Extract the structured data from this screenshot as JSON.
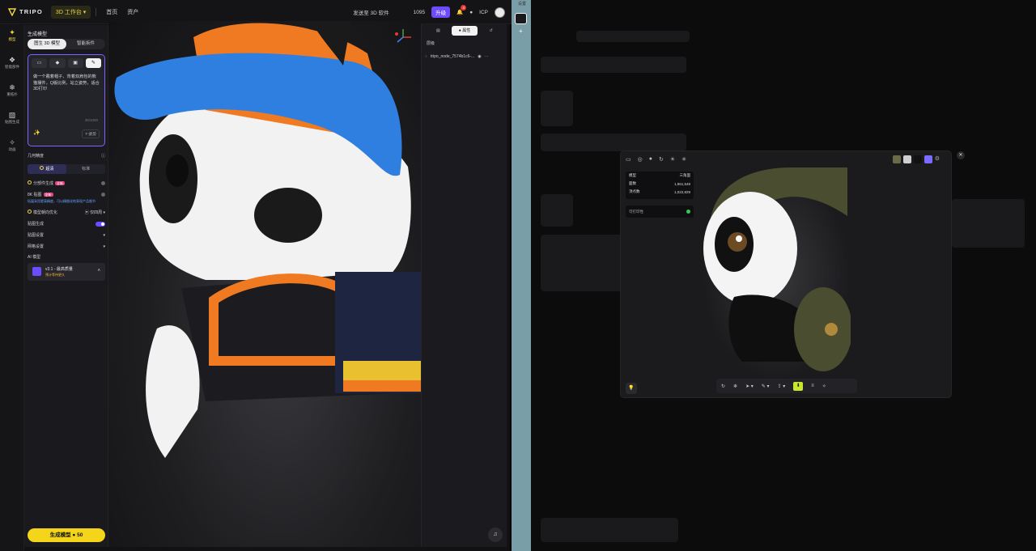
{
  "topbar": {
    "brand": "TRIPO",
    "workspace": "3D 工作台",
    "workspace_caret": "▾",
    "nav": [
      "首页",
      "资产"
    ],
    "send_to": "发送至 3D 软件",
    "credits": "1095",
    "upgrade": "升级",
    "notif_count": "4",
    "lang": "ICP"
  },
  "rail": [
    {
      "icon": "✦",
      "label": "模型"
    },
    {
      "icon": "❖",
      "label": "智能部件"
    },
    {
      "icon": "❄",
      "label": "重拓扑"
    },
    {
      "icon": "▨",
      "label": "贴图生成"
    },
    {
      "icon": "✧",
      "label": "动画"
    }
  ],
  "panel": {
    "title": "生成模型",
    "seg": [
      "图生 3D 模型",
      "智能拆件"
    ],
    "prompt": "做一个戴着帽子、背着双肩包的熊猫摆件，Q版比例，站立姿势，适合3D打印",
    "counter": "35/1000",
    "pose_btn": "T-姿势",
    "geometry_label": "几何精度",
    "quality": [
      "超清",
      "标准"
    ],
    "smart_low_poly": "分部件生成",
    "new_tag": "全新",
    "pbr": "8K 贴图",
    "pbr_tag": "全新",
    "hint": "拓展采用更高精度，可以精细化地表现产品细节",
    "symmetry": "模型朝向优化",
    "symmetry_value": "仅四周",
    "texture_gen": "贴图生成",
    "texture_settings": "贴图设置",
    "mesh_settings": "网格设置",
    "ai_model_label": "AI 模型",
    "model_name": "v3.1 - 最高质量",
    "model_sub": "预计等待更久",
    "generate": "生成模型",
    "cost": "50"
  },
  "rightpanel": {
    "tabs": [
      "",
      "属性",
      ""
    ],
    "layers": "层级",
    "node": "tripo_node_7574b1c6-..."
  },
  "modal": {
    "stats": [
      [
        "模型",
        "三角面"
      ],
      [
        "面数",
        "1,961,548"
      ],
      [
        "顶点数",
        "1,022,829"
      ]
    ],
    "print_ready": "可打印性",
    "swatch_colors": [
      "#6b6b4a",
      "#cfcfcf",
      "#111111",
      "#7a6cff"
    ]
  },
  "teal": {
    "top": "设置"
  }
}
